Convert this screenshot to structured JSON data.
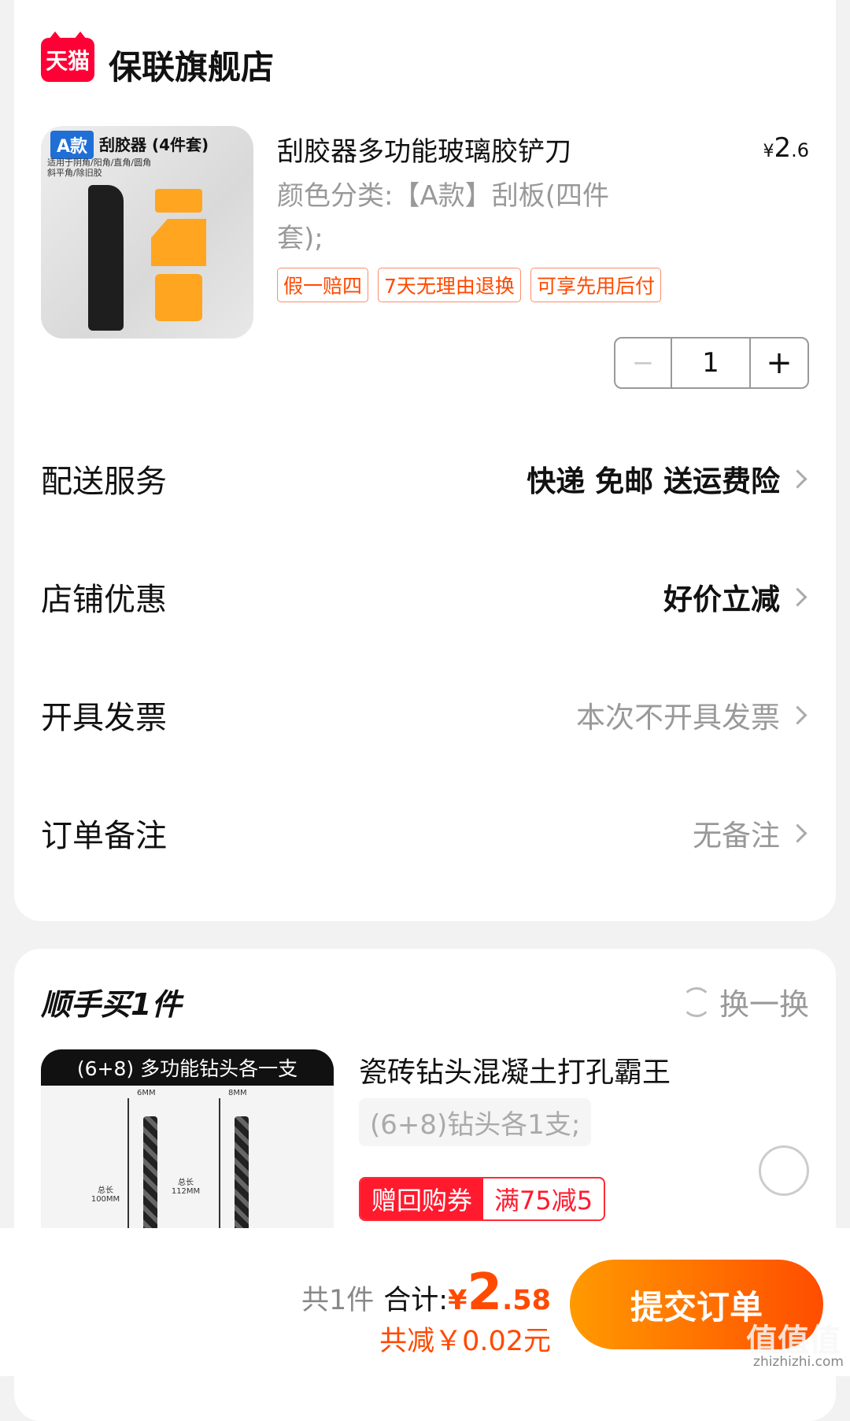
{
  "store": {
    "logo_text": "天猫",
    "name": "保联旗舰店"
  },
  "product1": {
    "image": {
      "badge": "A款",
      "title": "刮胶器 (4件套)",
      "subtitle": "适用于阴角/阳角/直角/圆角 斜平角/除旧胶"
    },
    "title": "刮胶器多功能玻璃胶铲刀",
    "price_currency": "¥",
    "price_int": "2",
    "price_dec": ".6",
    "sku": "颜色分类:【A款】刮板(四件套);",
    "tags": [
      "假一赔四",
      "7天无理由退换",
      "可享先用后付"
    ],
    "quantity": "1",
    "minus": "−",
    "plus": "+"
  },
  "rows": {
    "delivery": {
      "label": "配送服务",
      "value": "快递 免邮 送运费险"
    },
    "discount": {
      "label": "店铺优惠",
      "value": "好价立减"
    },
    "invoice": {
      "label": "开具发票",
      "value": "本次不开具发票"
    },
    "note": {
      "label": "订单备注",
      "value": "无备注"
    }
  },
  "addon": {
    "section_title": "顺手买1件",
    "swap_label": "换一换",
    "image": {
      "banner": "(6+8) 多功能钻头各一支",
      "label_6mm": "6MM",
      "label_8mm": "8MM",
      "len1": "总长 100MM",
      "len2": "总长 112MM"
    },
    "title": "瓷砖钻头混凝土打孔霸王",
    "sku": "(6+8)钻头各1支;",
    "coupon_left": "赠回购券",
    "coupon_right": "满75减5"
  },
  "summary": {
    "count": "共1件",
    "total_label": "合计:",
    "currency": "¥",
    "total_int": "2",
    "total_dec": ".58",
    "saving": "共减￥0.02元",
    "submit": "提交订单"
  },
  "watermark": {
    "text": "值值值",
    "url": "zhizhizhi.com"
  }
}
